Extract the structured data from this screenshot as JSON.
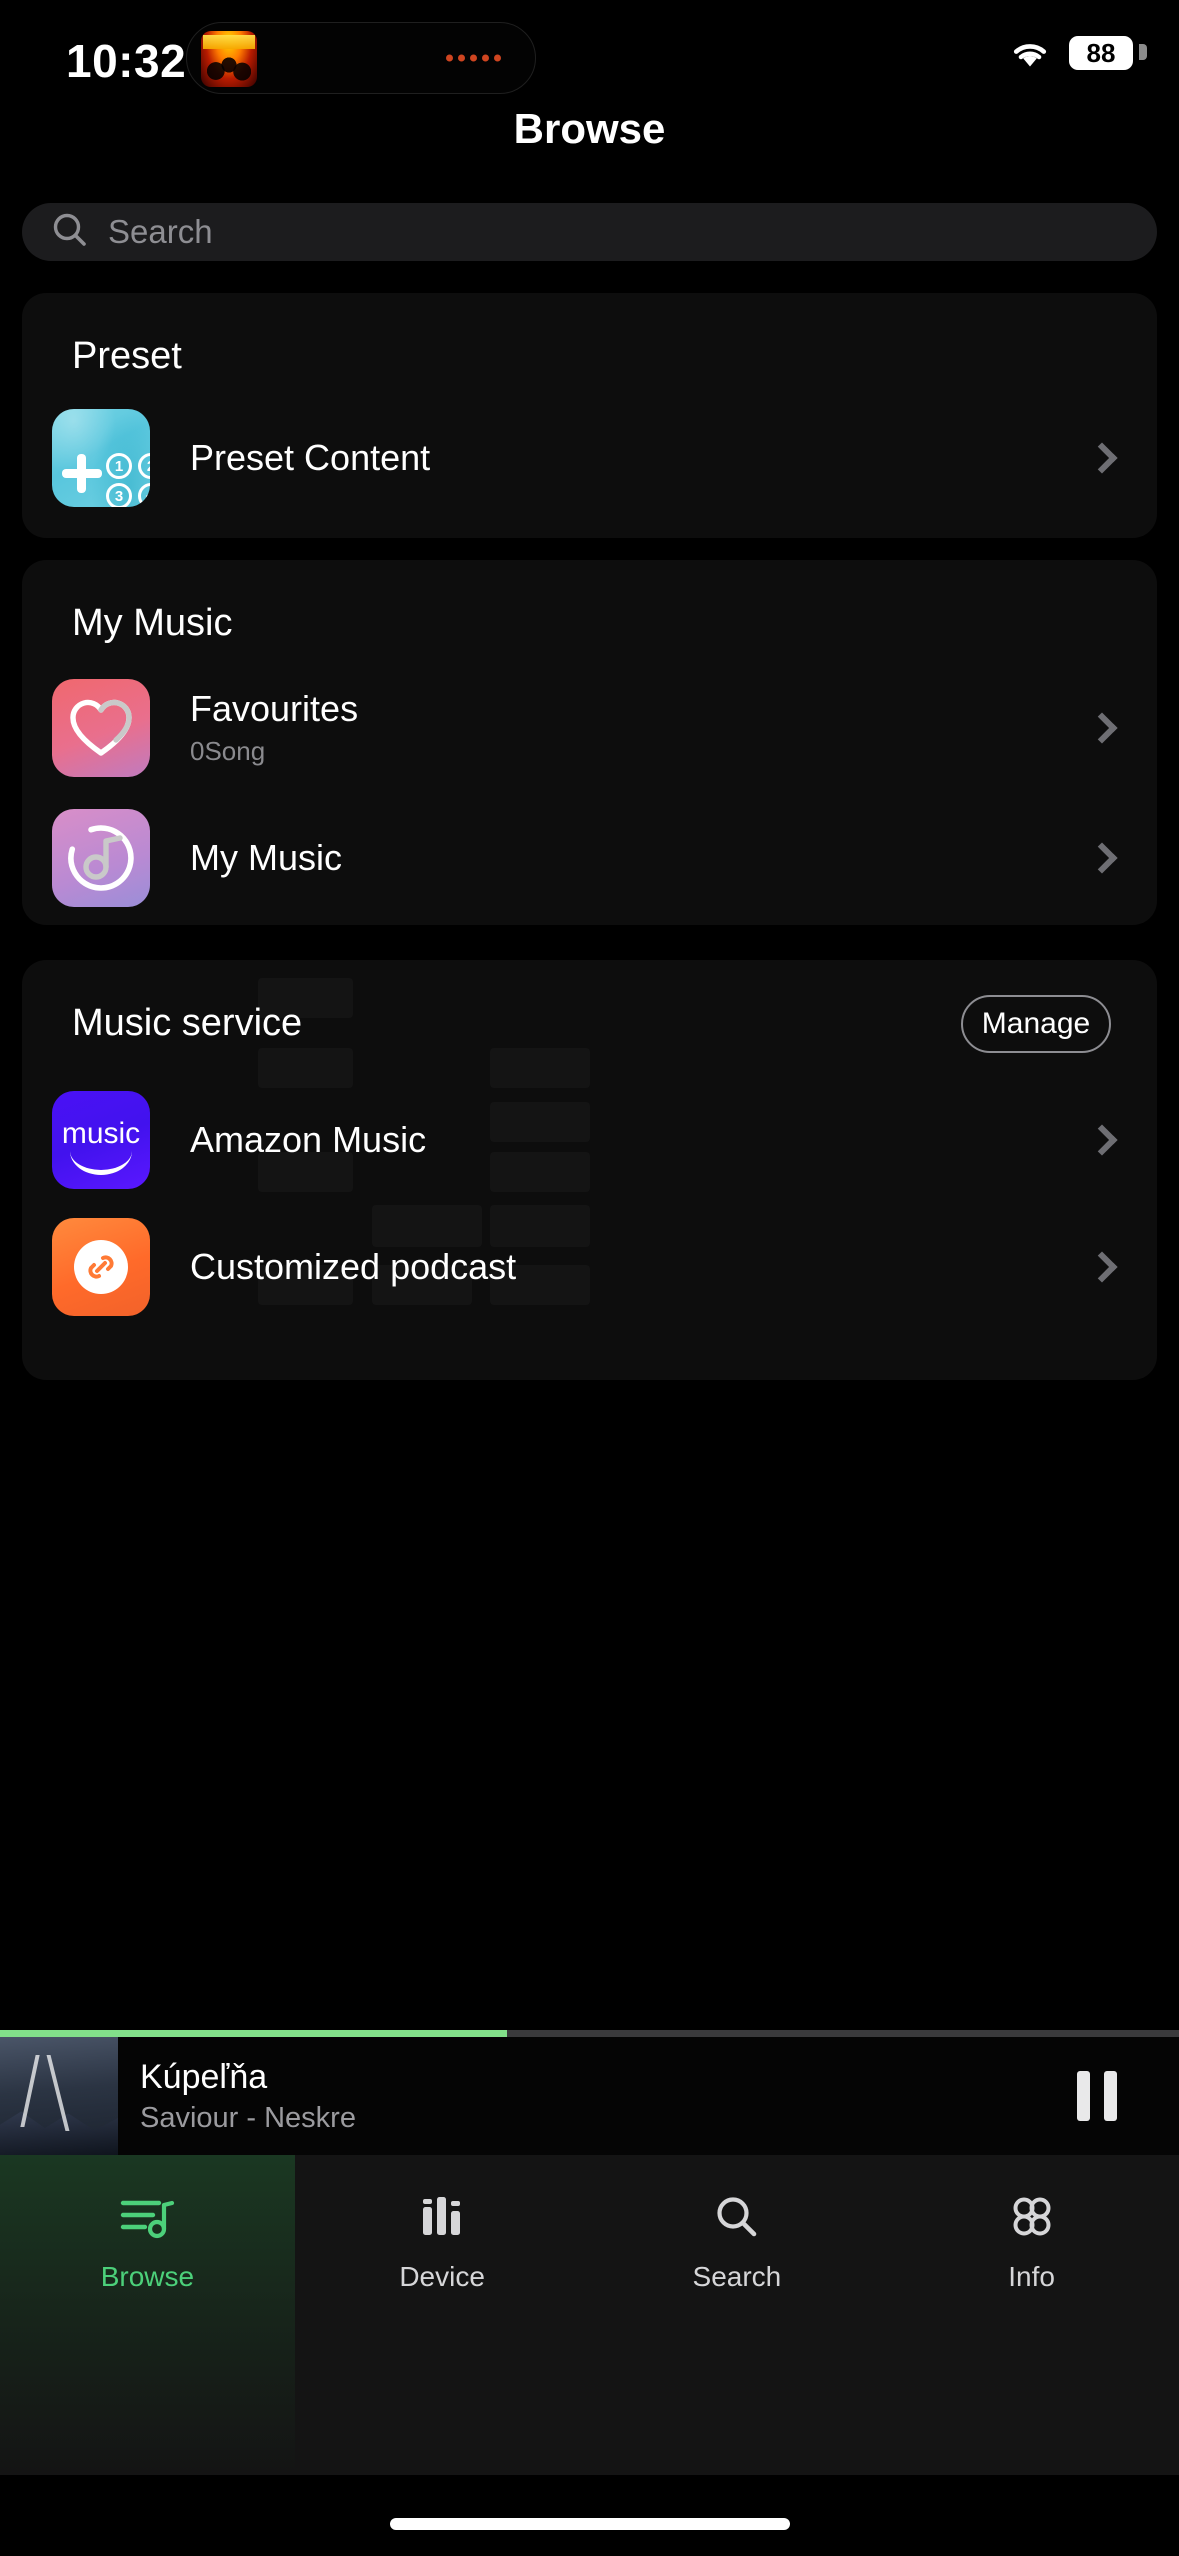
{
  "status_bar": {
    "time": "10:32",
    "battery_percent": "88",
    "wifi_icon": "wifi-icon",
    "island_art_icon": "album-art-thumbnail",
    "island_waveform_icon": "audio-waveform-dots"
  },
  "header": {
    "title": "Browse"
  },
  "search": {
    "placeholder": "Search",
    "icon": "search-icon"
  },
  "sections": {
    "preset": {
      "title": "Preset",
      "items": [
        {
          "label": "Preset Content",
          "icon": "preset-content-icon",
          "chevron": "chevron-right-icon"
        }
      ]
    },
    "my_music": {
      "title": "My Music",
      "items": [
        {
          "label": "Favourites",
          "sub": "0Song",
          "icon": "heart-icon",
          "chevron": "chevron-right-icon"
        },
        {
          "label": "My Music",
          "sub": "",
          "icon": "music-note-circle-icon",
          "chevron": "chevron-right-icon"
        }
      ]
    },
    "music_service": {
      "title": "Music service",
      "manage_label": "Manage",
      "items": [
        {
          "label": "Amazon Music",
          "icon": "amazon-music-icon",
          "icon_word": "music",
          "chevron": "chevron-right-icon"
        },
        {
          "label": "Customized podcast",
          "icon": "podcast-link-icon",
          "chevron": "chevron-right-icon"
        }
      ]
    }
  },
  "mini_player": {
    "title": "Kúpeľňa",
    "artist": "Saviour - Neskre",
    "progress_percent": 43,
    "progress_color": "#82e08a",
    "pause_icon": "pause-icon",
    "artwork_icon": "album-artwork"
  },
  "tab_bar": {
    "items": [
      {
        "label": "Browse",
        "icon": "browse-playlist-icon",
        "active": true
      },
      {
        "label": "Device",
        "icon": "device-equalizer-icon",
        "active": false
      },
      {
        "label": "Search",
        "icon": "search-icon",
        "active": false
      },
      {
        "label": "Info",
        "icon": "info-grid-icon",
        "active": false
      }
    ],
    "active_color": "#4cd07a"
  }
}
